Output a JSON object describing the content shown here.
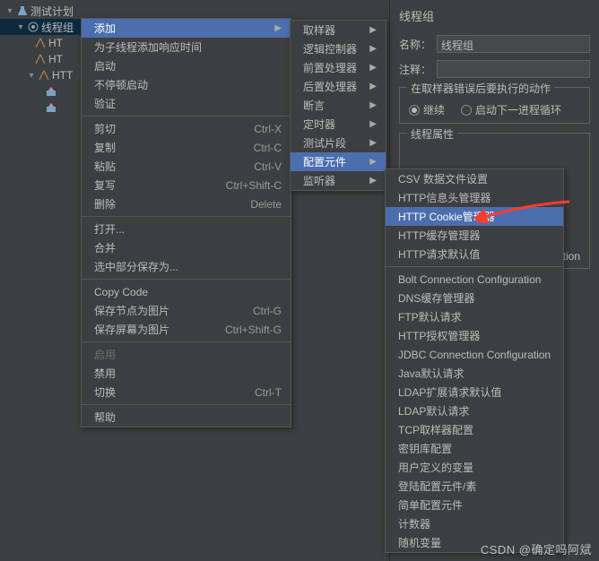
{
  "tree": {
    "root": "测试计划",
    "thread_group": "线程组",
    "children": [
      "HT",
      "HT",
      "HTT"
    ]
  },
  "props": {
    "title": "线程组",
    "name_label": "名称：",
    "name_value": "线程组",
    "comment_label": "注释：",
    "box1_title": "在取样器错误后要执行的动作",
    "radio_continue": "继续",
    "radio_next": "启动下一进程循环",
    "box2_title": "线程属性",
    "right_suffix": "tion"
  },
  "m1": [
    {
      "t": "添加",
      "arrow": true,
      "hl": true
    },
    {
      "t": "为子线程添加响应时间"
    },
    {
      "t": "启动"
    },
    {
      "t": "不停顿启动"
    },
    {
      "t": "验证"
    },
    {
      "sep": true
    },
    {
      "t": "剪切",
      "sc": "Ctrl-X"
    },
    {
      "t": "复制",
      "sc": "Ctrl-C"
    },
    {
      "t": "粘贴",
      "sc": "Ctrl-V"
    },
    {
      "t": "复写",
      "sc": "Ctrl+Shift-C"
    },
    {
      "t": "删除",
      "sc": "Delete"
    },
    {
      "sep": true
    },
    {
      "t": "打开..."
    },
    {
      "t": "合并"
    },
    {
      "t": "选中部分保存为..."
    },
    {
      "sep": true
    },
    {
      "t": "Copy Code"
    },
    {
      "t": "保存节点为图片",
      "sc": "Ctrl-G"
    },
    {
      "t": "保存屏幕为图片",
      "sc": "Ctrl+Shift-G"
    },
    {
      "sep": true
    },
    {
      "t": "启用",
      "disabled": true
    },
    {
      "t": "禁用"
    },
    {
      "t": "切换",
      "sc": "Ctrl-T"
    },
    {
      "sep": true
    },
    {
      "t": "帮助"
    }
  ],
  "m2": [
    {
      "t": "取样器",
      "arrow": true
    },
    {
      "t": "逻辑控制器",
      "arrow": true
    },
    {
      "t": "前置处理器",
      "arrow": true
    },
    {
      "t": "后置处理器",
      "arrow": true
    },
    {
      "t": "断言",
      "arrow": true
    },
    {
      "t": "定时器",
      "arrow": true
    },
    {
      "t": "测试片段",
      "arrow": true
    },
    {
      "t": "配置元件",
      "arrow": true,
      "hl": true
    },
    {
      "t": "监听器",
      "arrow": true
    }
  ],
  "m3": [
    {
      "t": "CSV 数据文件设置"
    },
    {
      "t": "HTTP信息头管理器"
    },
    {
      "t": "HTTP Cookie管理器",
      "hl": true
    },
    {
      "t": "HTTP缓存管理器"
    },
    {
      "t": "HTTP请求默认值"
    },
    {
      "sep": true
    },
    {
      "t": "Bolt Connection Configuration"
    },
    {
      "t": "DNS缓存管理器"
    },
    {
      "t": "FTP默认请求"
    },
    {
      "t": "HTTP授权管理器"
    },
    {
      "t": "JDBC Connection Configuration"
    },
    {
      "t": "Java默认请求"
    },
    {
      "t": "LDAP扩展请求默认值"
    },
    {
      "t": "LDAP默认请求"
    },
    {
      "t": "TCP取样器配置"
    },
    {
      "t": "密钥库配置"
    },
    {
      "t": "用户定义的变量"
    },
    {
      "t": "登陆配置元件/素"
    },
    {
      "t": "简单配置元件"
    },
    {
      "t": "计数器"
    },
    {
      "t": "随机变量"
    }
  ],
  "watermark": "CSDN @确定吗阿斌"
}
